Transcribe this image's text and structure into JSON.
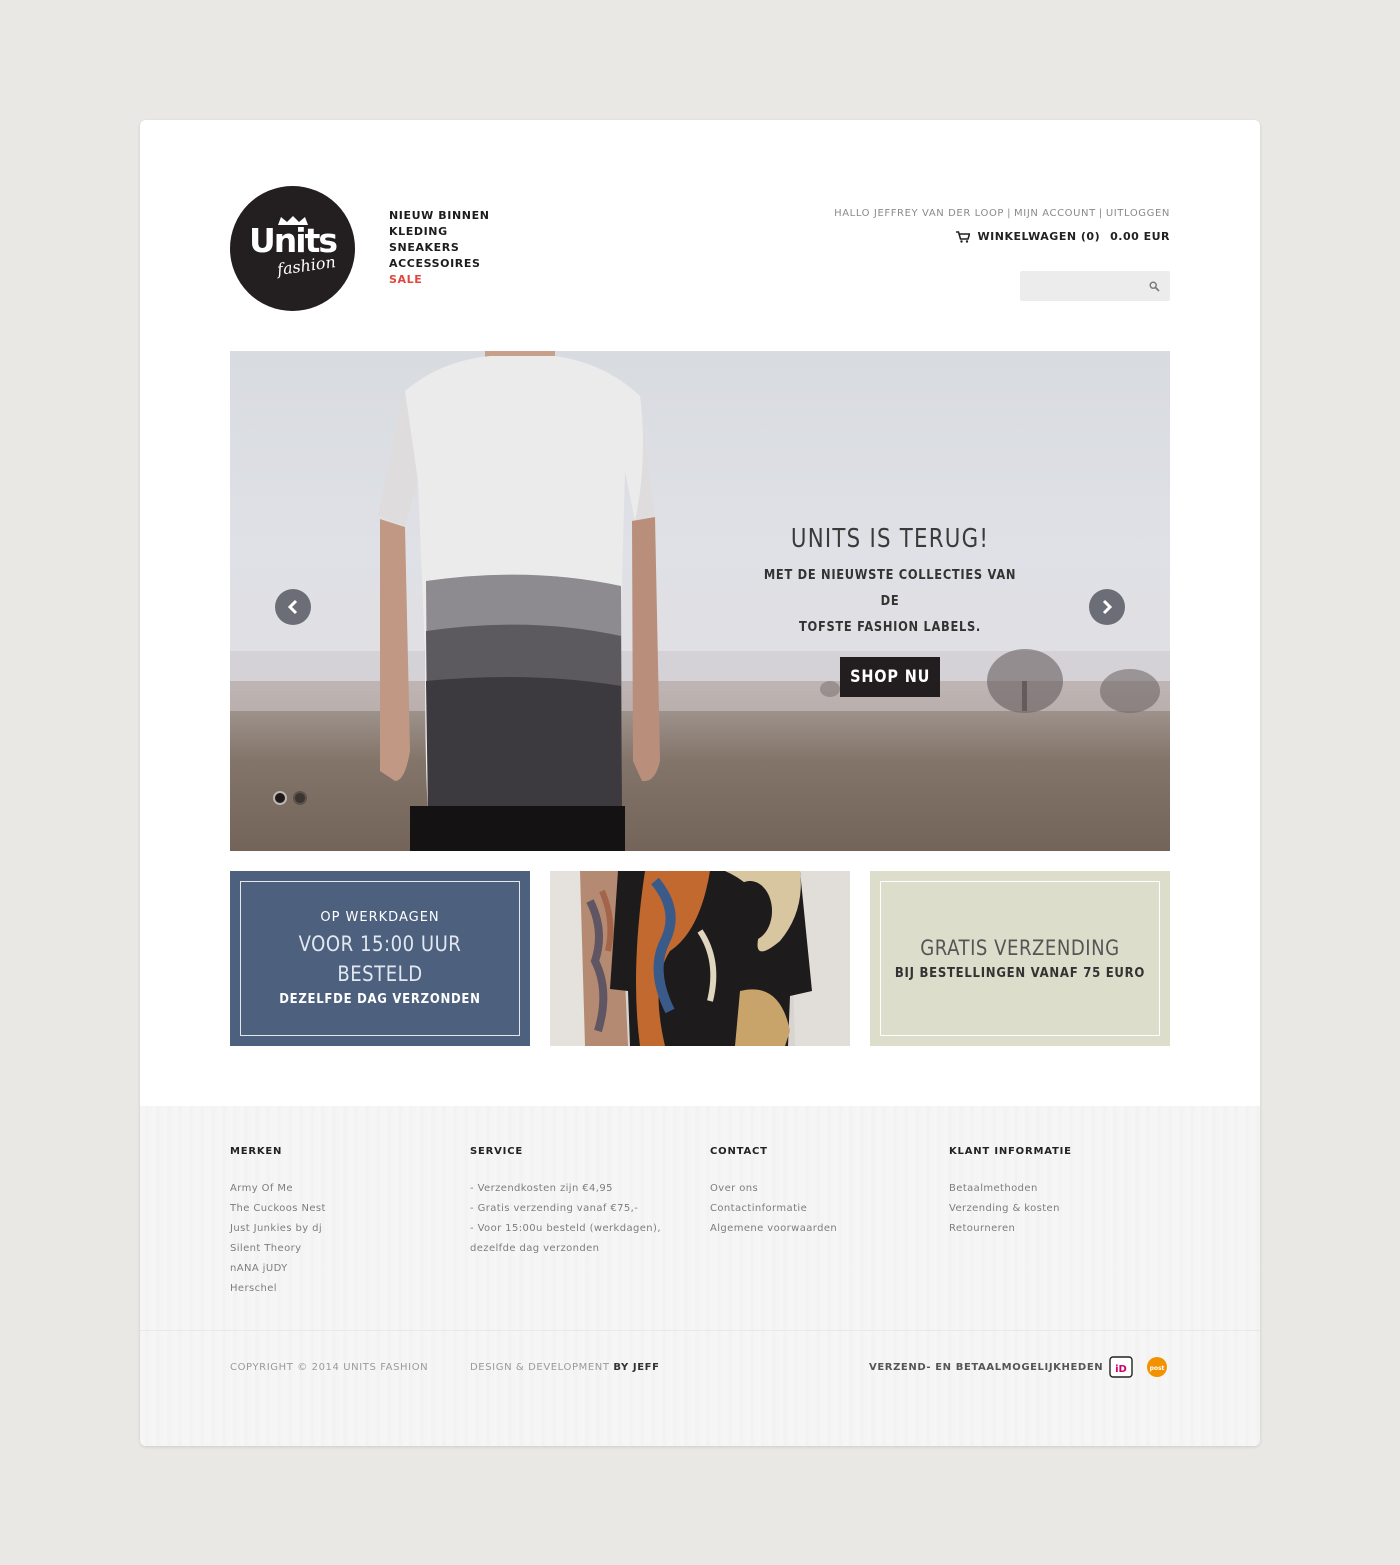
{
  "logo": {
    "main": "Units",
    "sub": "fashion"
  },
  "nav": {
    "items": [
      "NIEUW BINNEN",
      "KLEDING",
      "SNEAKERS",
      "ACCESSOIRES"
    ],
    "sale": "SALE"
  },
  "account": {
    "greeting": "HALLO JEFFREY VAN DER LOOP",
    "my_account": "MIJN ACCOUNT",
    "logout": "UITLOGGEN",
    "separator": "|"
  },
  "cart": {
    "label": "WINKELWAGEN (0)",
    "amount": "0.00 EUR"
  },
  "search": {
    "placeholder": "",
    "icon": "search-icon"
  },
  "hero": {
    "title": "UNITS IS TERUG!",
    "subtitle": "MET DE NIEUWSTE COLLECTIES VAN DE\nTOFSTE FASHION LABELS.",
    "button": "SHOP NU",
    "slides": 2,
    "active_slide": 1
  },
  "promos": {
    "delivery": {
      "line1": "OP WERKDAGEN",
      "line2": "VOOR 15:00 UUR BESTELD",
      "line3": "DEZELFDE DAG VERZONDEN"
    },
    "shipping": {
      "line1": "GRATIS VERZENDING",
      "line2": "BIJ BESTELLINGEN VANAF 75 EURO"
    }
  },
  "footer": {
    "merken": {
      "title": "MERKEN",
      "items": [
        "Army Of Me",
        "The Cuckoos Nest",
        "Just Junkies by dj",
        "Silent Theory",
        "nANA jUDY",
        "Herschel"
      ]
    },
    "service": {
      "title": "SERVICE",
      "items": [
        "- Verzendkosten zijn €4,95",
        "- Gratis verzending vanaf €75,-",
        "- Voor 15:00u besteld (werkdagen),",
        "dezelfde dag verzonden"
      ]
    },
    "contact": {
      "title": "CONTACT",
      "items": [
        "Over ons",
        "Contactinformatie",
        "Algemene voorwaarden"
      ]
    },
    "klant": {
      "title": "KLANT INFORMATIE",
      "items": [
        "Betaalmethoden",
        "Verzending & kosten",
        "Retourneren"
      ]
    },
    "copyright": "COPYRIGHT © 2014 UNITS FASHION",
    "design": "DESIGN & DEVELOPMENT",
    "design_by": "BY JEFF",
    "payment_label": "VERZEND- EN BETAALMOGELIJKHEDEN",
    "payment_icons": [
      "ideal-icon",
      "postnl-icon"
    ],
    "ideal_label": "iD",
    "postnl_label": "post"
  },
  "colors": {
    "background": "#e9e8e4",
    "sale": "#e0473f",
    "promo_blue": "#4d617f",
    "promo_green": "#dcdecb",
    "button_dark": "#221e1f"
  }
}
